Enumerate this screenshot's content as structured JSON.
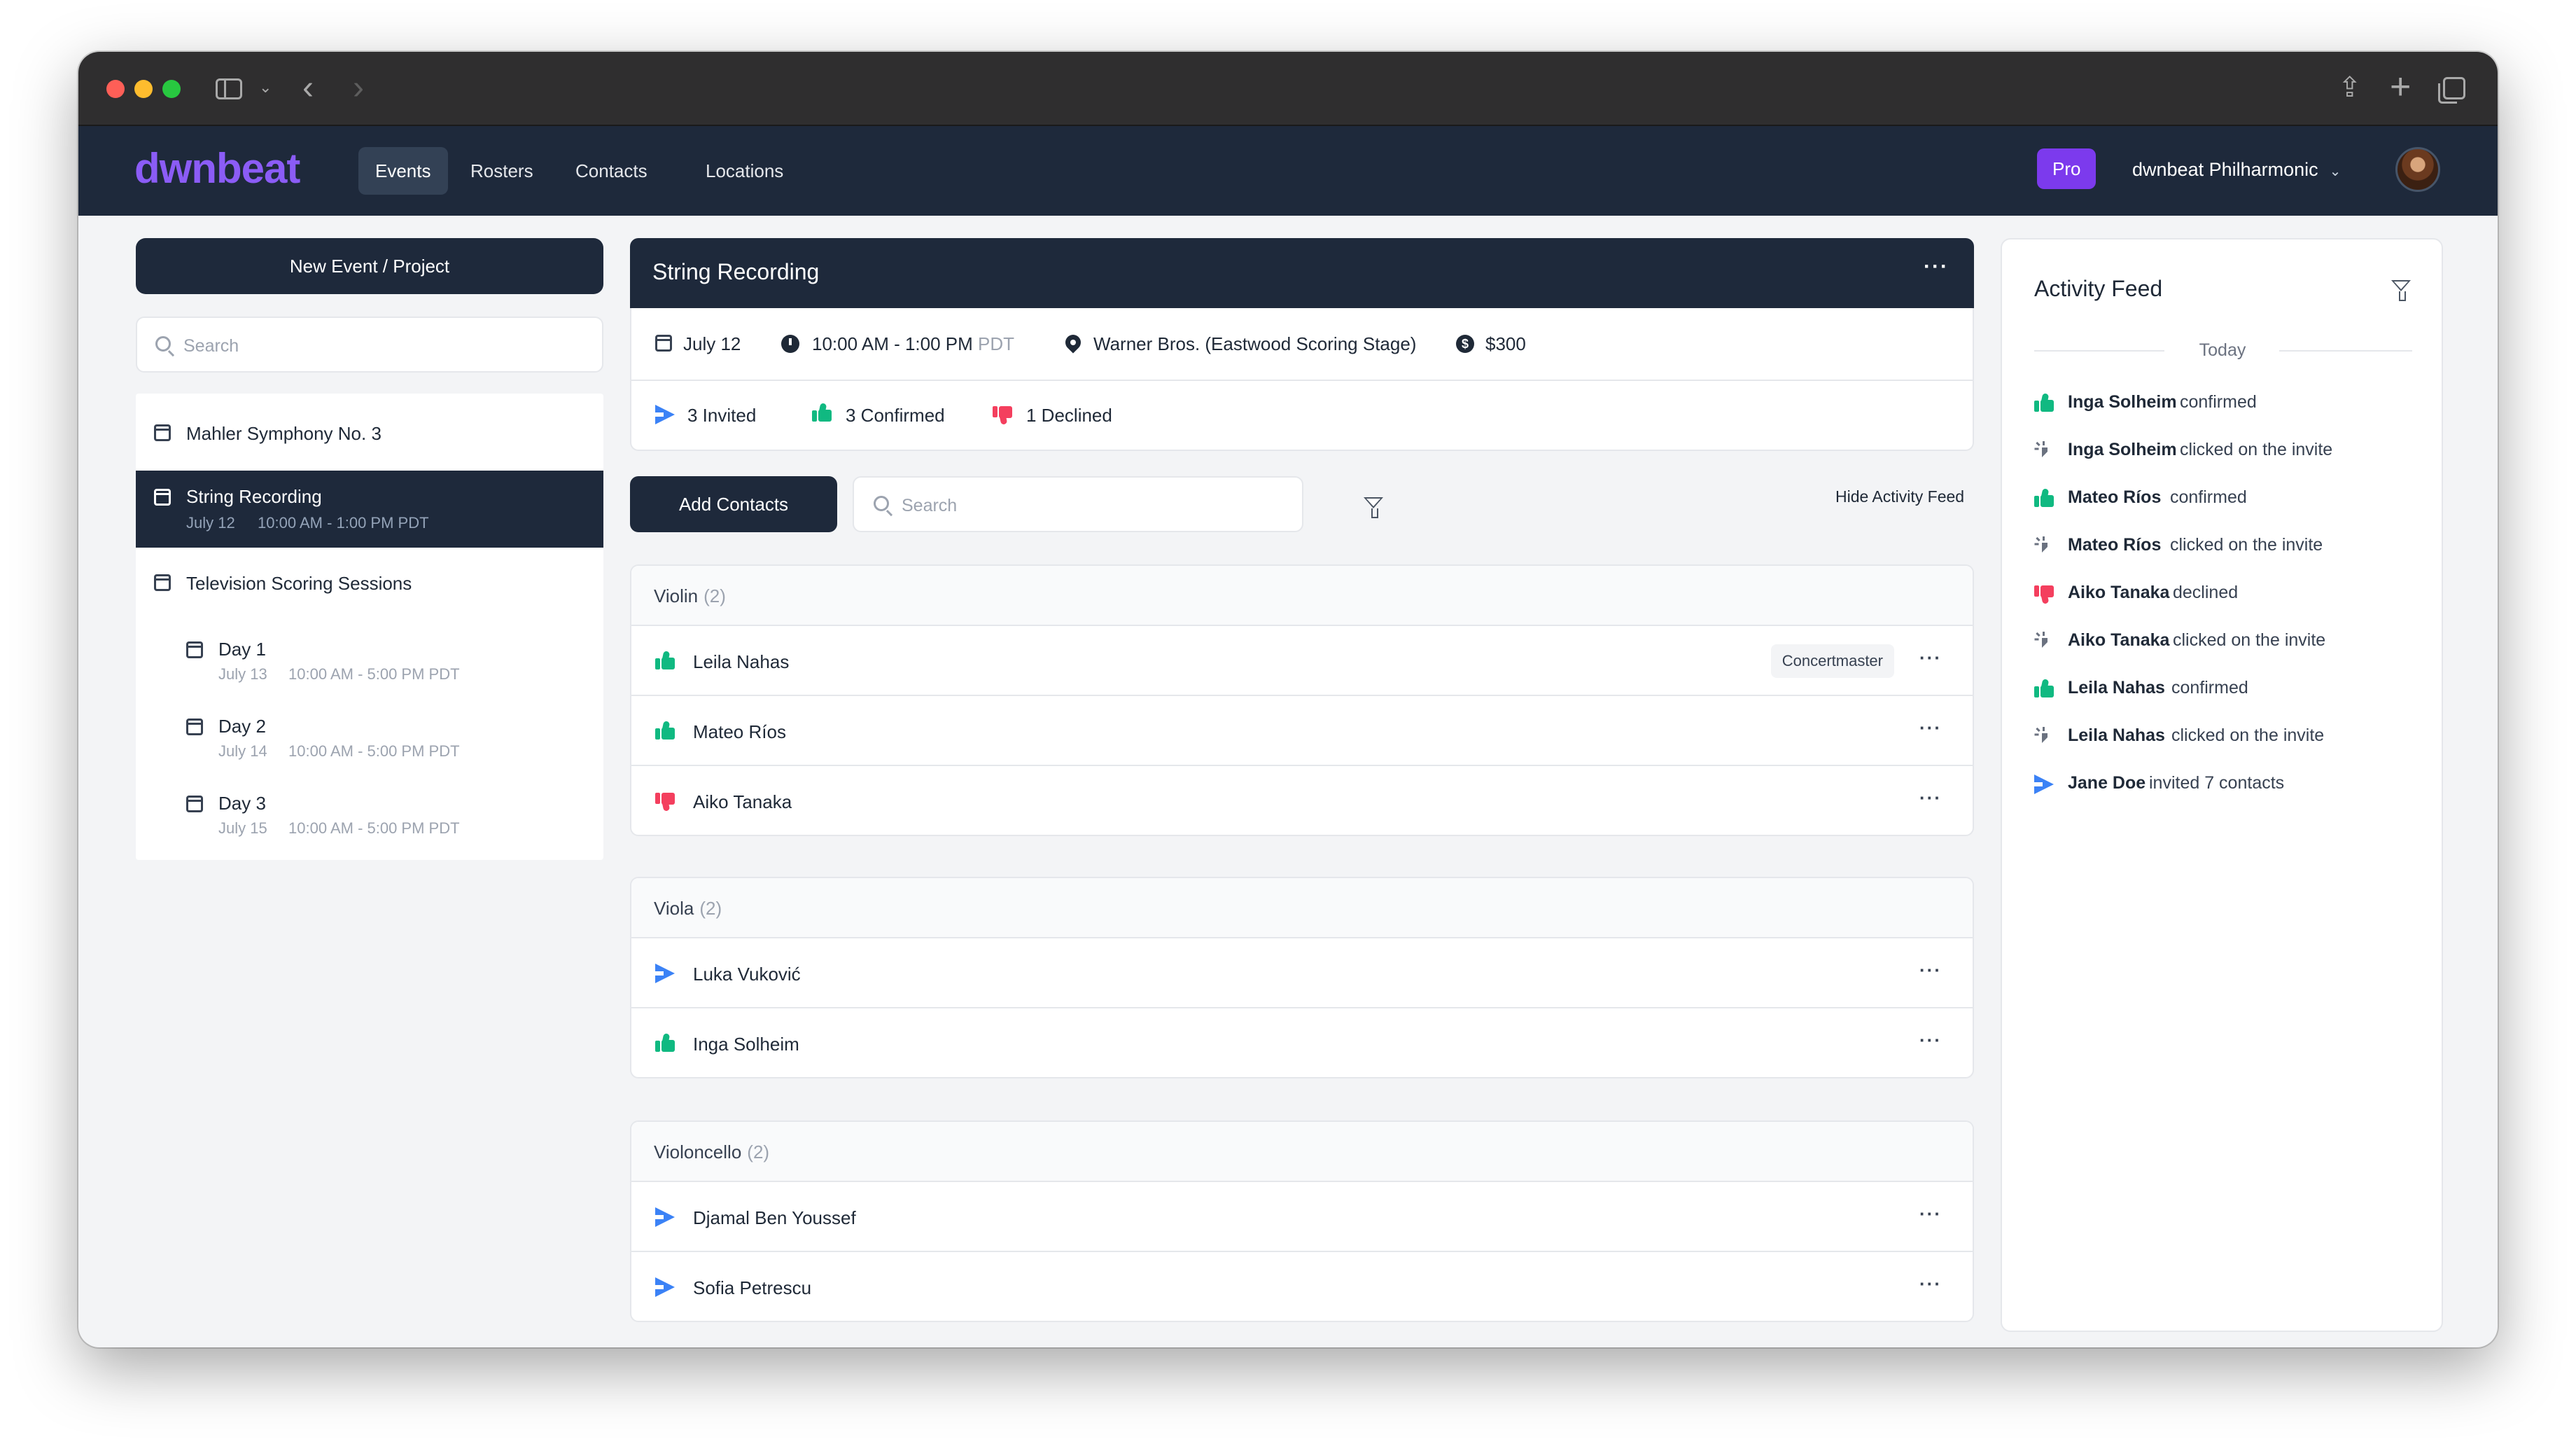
{
  "app": {
    "logo": "dwnbeat",
    "nav": [
      "Events",
      "Rosters",
      "Contacts",
      "Locations"
    ],
    "active_nav": "Events",
    "plan_badge": "Pro",
    "organization": "dwnbeat Philharmonic"
  },
  "sidebar": {
    "new_button": "New Event / Project",
    "search_placeholder": "Search",
    "events": [
      {
        "title": "Mahler Symphony No. 3"
      },
      {
        "title": "String Recording",
        "date": "July 12",
        "time": "10:00 AM - 1:00 PM PDT",
        "selected": true
      },
      {
        "title": "Television Scoring Sessions"
      },
      {
        "title": "Day 1",
        "date": "July 13",
        "time": "10:00 AM - 5:00 PM PDT"
      },
      {
        "title": "Day 2",
        "date": "July 14",
        "time": "10:00 AM - 5:00 PM PDT"
      },
      {
        "title": "Day 3",
        "date": "July 15",
        "time": "10:00 AM - 5:00 PM PDT"
      }
    ]
  },
  "event": {
    "title": "String Recording",
    "date": "July 12",
    "time": "10:00 AM - 1:00 PM",
    "timezone": "PDT",
    "location": "Warner Bros. (Eastwood Scoring Stage)",
    "fee": "$300",
    "stats": {
      "invited": "3 Invited",
      "confirmed": "3 Confirmed",
      "declined": "1 Declined"
    }
  },
  "toolbar": {
    "add_contacts": "Add Contacts",
    "search_placeholder": "Search",
    "hide_feed": "Hide Activity Feed"
  },
  "groups": [
    {
      "name": "Violin",
      "count": "(2)",
      "members": [
        {
          "name": "Leila Nahas",
          "status": "confirmed",
          "role": "Concertmaster"
        },
        {
          "name": "Mateo Ríos",
          "status": "confirmed"
        },
        {
          "name": "Aiko Tanaka",
          "status": "declined"
        }
      ]
    },
    {
      "name": "Viola",
      "count": "(2)",
      "members": [
        {
          "name": "Luka Vuković",
          "status": "invited"
        },
        {
          "name": "Inga Solheim",
          "status": "confirmed"
        }
      ]
    },
    {
      "name": "Violoncello",
      "count": "(2)",
      "members": [
        {
          "name": "Djamal Ben Youssef",
          "status": "invited"
        },
        {
          "name": "Sofia Petrescu",
          "status": "invited"
        }
      ]
    }
  ],
  "feed": {
    "title": "Activity Feed",
    "section": "Today",
    "items": [
      {
        "who": "Inga Solheim",
        "what": "confirmed",
        "icon": "thumbs-up-icon"
      },
      {
        "who": "Inga Solheim",
        "what": "clicked on the invite",
        "icon": "click-icon"
      },
      {
        "who": "Mateo Ríos",
        "what": "confirmed",
        "icon": "thumbs-up-icon"
      },
      {
        "who": "Mateo Ríos",
        "what": "clicked on the invite",
        "icon": "click-icon"
      },
      {
        "who": "Aiko Tanaka",
        "what": "declined",
        "icon": "thumbs-down-icon"
      },
      {
        "who": "Aiko Tanaka",
        "what": "clicked on the invite",
        "icon": "click-icon"
      },
      {
        "who": "Leila Nahas",
        "what": "confirmed",
        "icon": "thumbs-up-icon"
      },
      {
        "who": "Leila Nahas",
        "what": "clicked on the invite",
        "icon": "click-icon"
      },
      {
        "who": "Jane Doe",
        "what": "invited 7 contacts",
        "icon": "send-icon"
      }
    ]
  },
  "colors": {
    "navy": "#1e293b",
    "brand_purple": "#8b5cf6",
    "pro_purple": "#7c3aed",
    "confirmed_green": "#10b981",
    "declined_red": "#f43f5e",
    "invited_blue": "#3b82f6"
  }
}
